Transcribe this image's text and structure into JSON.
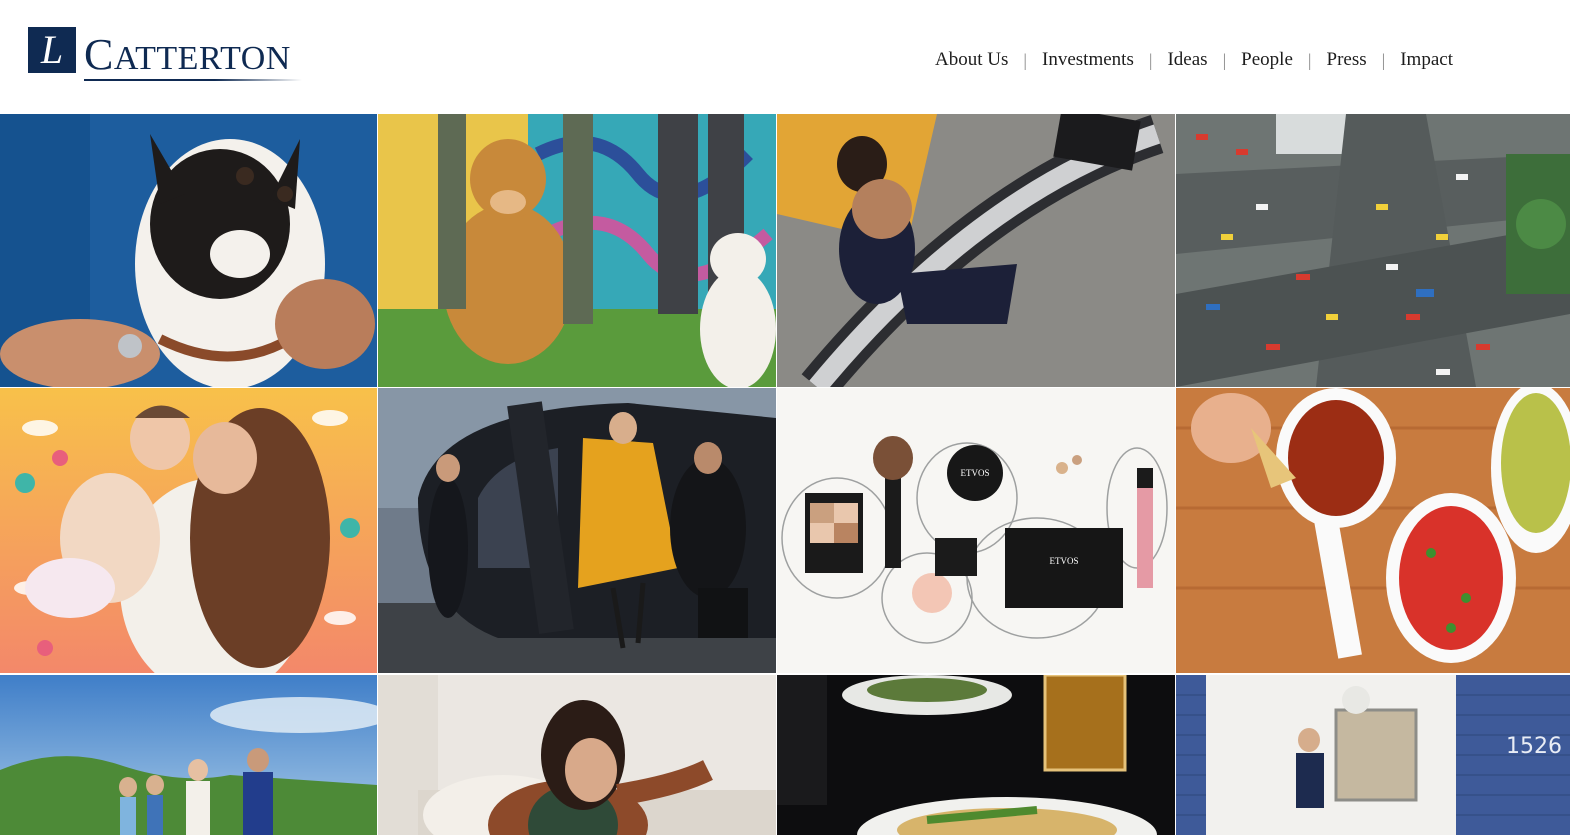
{
  "brand": {
    "logo_letter": "L",
    "logo_cap": "C",
    "logo_rest": "ATTERTON"
  },
  "nav": {
    "items": [
      "About Us",
      "Investments",
      "Ideas",
      "People",
      "Press",
      "Impact"
    ],
    "separator": "|"
  },
  "tiles": {
    "etvos_brand": "ETVOS",
    "etvos_brand_box": "ETVOS",
    "house_number": "1526"
  },
  "colors": {
    "brand_navy": "#0f2a52",
    "nav_text": "#1d1d1d"
  }
}
